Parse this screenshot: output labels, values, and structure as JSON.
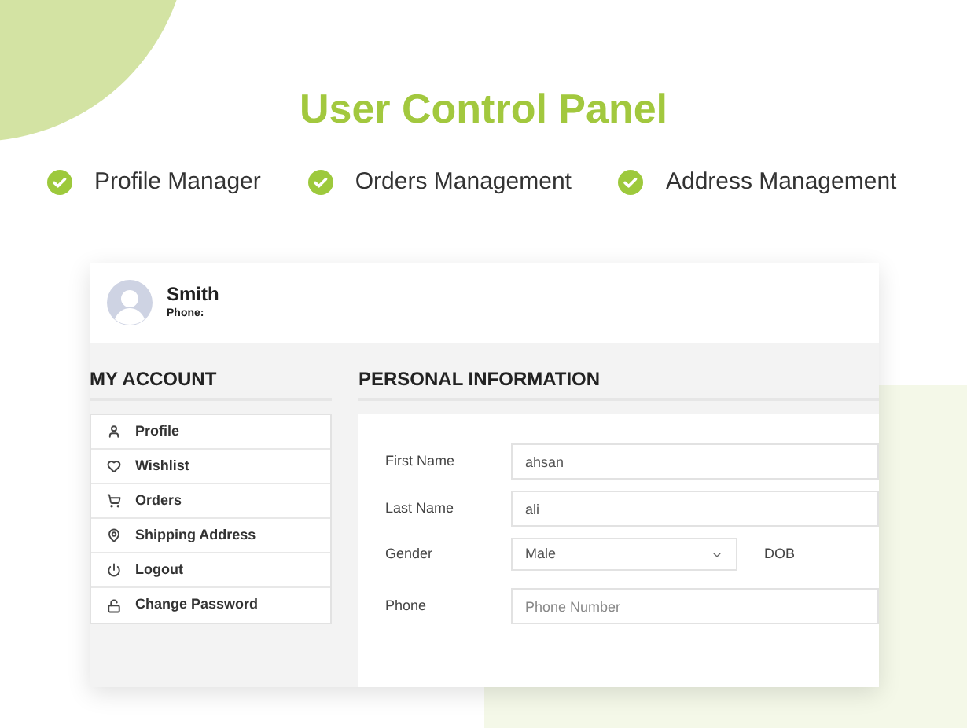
{
  "title": "User Control Panel",
  "features": [
    "Profile Manager",
    "Orders Management",
    "Address Management"
  ],
  "user": {
    "name": "Smith",
    "phone_label": "Phone:"
  },
  "sidebar": {
    "title": "MY ACCOUNT",
    "items": [
      "Profile",
      "Wishlist",
      "Orders",
      "Shipping Address",
      "Logout",
      "Change Password"
    ]
  },
  "personal_information": {
    "title": "PERSONAL INFORMATION",
    "first_name": {
      "label": "First Name",
      "value": "ahsan"
    },
    "last_name": {
      "label": "Last Name",
      "value": "ali"
    },
    "gender": {
      "label": "Gender",
      "value": "Male"
    },
    "dob": {
      "label": "DOB"
    },
    "phone": {
      "label": "Phone",
      "placeholder": "Phone Number"
    }
  }
}
